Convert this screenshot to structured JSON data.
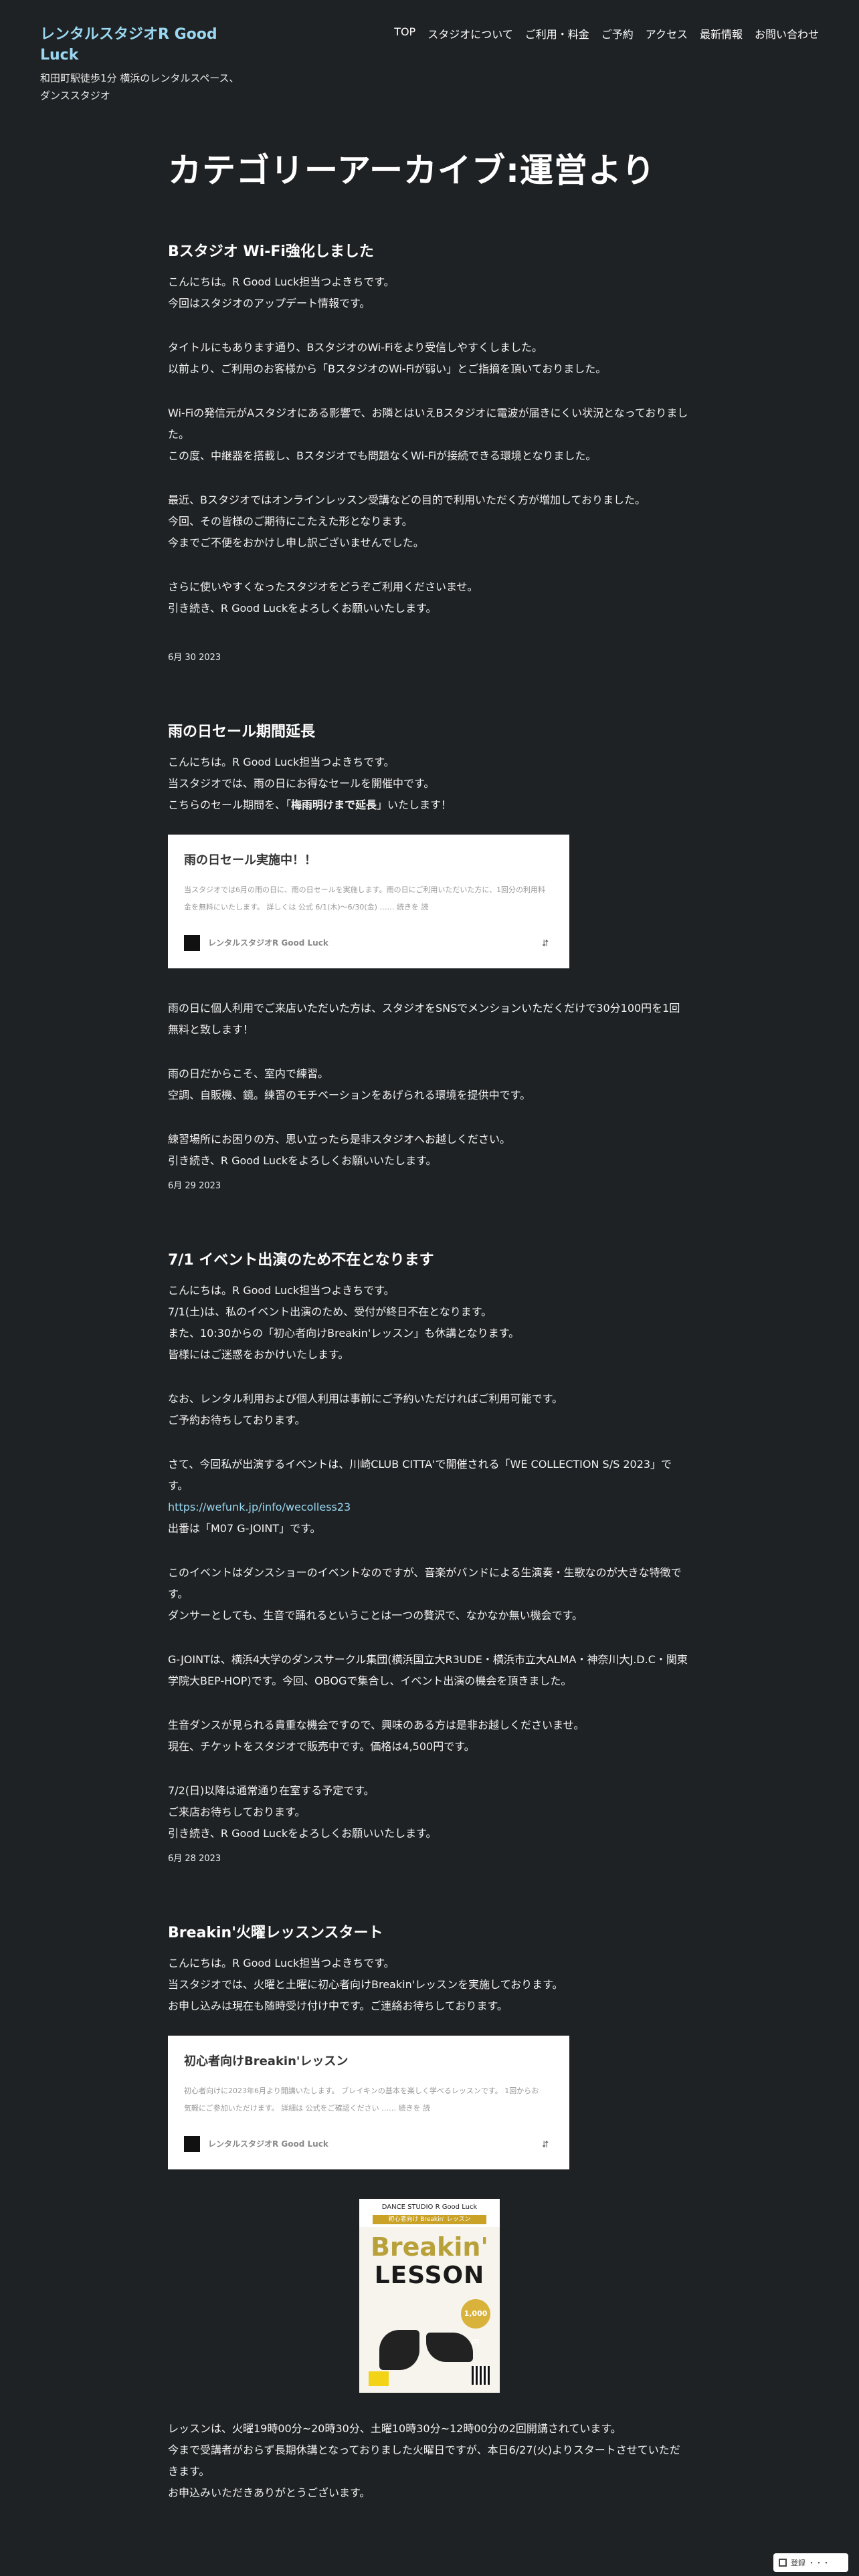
{
  "header": {
    "site_title": "レンタルスタジオR Good Luck",
    "site_description": "和田町駅徒歩1分 横浜のレンタルスペース、ダンススタジオ",
    "nav": [
      "TOP",
      "スタジオについて",
      "ご利用・料金",
      "ご予約",
      "アクセス",
      "最新情報",
      "お問い合わせ"
    ]
  },
  "archive_title": "カテゴリーアーカイブ:運営より",
  "posts": [
    {
      "title": "Bスタジオ Wi-Fi強化しました",
      "paragraphs": [
        [
          "こんにちは。R Good Luck担当つよきちです。",
          "今回はスタジオのアップデート情報です。"
        ],
        [
          "タイトルにもあります通り、BスタジオのWi-Fiをより受信しやすくしました。",
          "以前より、ご利用のお客様から「BスタジオのWi-Fiが弱い」とご指摘を頂いておりました。"
        ],
        [
          "Wi-Fiの発信元がAスタジオにある影響で、お隣とはいえBスタジオに電波が届きにくい状況となっておりました。",
          "この度、中継器を搭載し、Bスタジオでも問題なくWi-Fiが接続できる環境となりました。"
        ],
        [
          "最近、Bスタジオではオンラインレッスン受講などの目的で利用いただく方が増加しておりました。",
          "今回、その皆様のご期待にこたえた形となります。",
          "今までご不便をおかけし申し訳ございませんでした。"
        ],
        [
          "さらに使いやすくなったスタジオをどうぞご利用くださいませ。",
          "引き続き、R Good Luckをよろしくお願いいたします。"
        ]
      ],
      "date": "6月 30 2023"
    },
    {
      "title": "雨の日セール期間延長",
      "paragraphs_before": [
        [
          "こんにちは。R Good Luck担当つよきちです。",
          "当スタジオでは、雨の日にお得なセールを開催中です。",
          "こちらのセール期間を、「梅雨明けまで延長」いたします！"
        ]
      ],
      "bold_phrase": "梅雨明けまで延長",
      "embed": {
        "title": "雨の日セール実施中！！",
        "excerpt": "当スタジオでは6月の雨の日に、雨の日セールを実施します。雨の日にご利用いただいた方に、1回分の利用料金を無料にいたします。 詳しくは 公式 6/1(木)～6/30(金) …… 続きを 読",
        "site": "レンタルスタジオR Good Luck"
      },
      "paragraphs_after": [
        [
          "雨の日に個人利用でご来店いただいた方は、スタジオをSNSでメンションいただくだけで30分100円を1回無料と致します！"
        ],
        [
          "雨の日だからこそ、室内で練習。",
          "空調、自販機、鏡。練習のモチベーションをあげられる環境を提供中です。"
        ],
        [
          "練習場所にお困りの方、思い立ったら是非スタジオへお越しください。",
          "引き続き、R Good Luckをよろしくお願いいたします。"
        ]
      ],
      "date": "6月 29 2023"
    },
    {
      "title": "7/1 イベント出演のため不在となります",
      "paragraphs": [
        [
          "こんにちは。R Good Luck担当つよきちです。",
          "7/1(土)は、私のイベント出演のため、受付が終日不在となります。",
          "また、10:30からの「初心者向けBreakin'レッスン」も休講となります。",
          "皆様にはご迷惑をおかけいたします。"
        ],
        [
          "なお、レンタル利用および個人利用は事前にご予約いただければご利用可能です。",
          "ご予約お待ちしております。"
        ],
        [
          "さて、今回私が出演するイベントは、川崎CLUB CITTA'で開催される「WE COLLECTION S/S 2023」です。",
          "https://wefunk.jp/info/wecolless23",
          "出番は「M07 G-JOINT」です。"
        ],
        [
          "このイベントはダンスショーのイベントなのですが、音楽がバンドによる生演奏・生歌なのが大きな特徴です。",
          "ダンサーとしても、生音で踊れるということは一つの贅沢で、なかなか無い機会です。"
        ],
        [
          "G-JOINTは、横浜4大学のダンスサークル集団(横浜国立大R3UDE・横浜市立大ALMA・神奈川大J.D.C・関東学院大BEP-HOP)です。今回、OBOGで集合し、イベント出演の機会を頂きました。"
        ],
        [
          "生音ダンスが見られる貴重な機会ですので、興味のある方は是非お越しくださいませ。",
          "現在、チケットをスタジオで販売中です。価格は4,500円です。"
        ],
        [
          "7/2(日)以降は通常通り在室する予定です。",
          "ご来店お待ちしております。",
          "引き続き、R Good Luckをよろしくお願いいたします。"
        ]
      ],
      "link_text": "https://wefunk.jp/info/wecolless23",
      "date": "6月 28 2023"
    },
    {
      "title": "Breakin'火曜レッスンスタート",
      "paragraphs_before": [
        [
          "こんにちは。R Good Luck担当つよきちです。",
          "当スタジオでは、火曜と土曜に初心者向けBreakin'レッスンを実施しております。",
          "お申し込みは現在も随時受け付け中です。ご連絡お待ちしております。"
        ]
      ],
      "embed": {
        "title": "初心者向けBreakin'レッスン",
        "excerpt": "初心者向けに2023年6月より開講いたします。 ブレイキンの基本を楽しく学べるレッスンです。 1回からお気軽にご参加いただけます。 詳細は 公式をご確認ください …… 続きを 読",
        "site": "レンタルスタジオR Good Luck"
      },
      "poster": {
        "top_text": "DANCE STUDIO R Good Luck",
        "strip_text": "初心者向け Breakin' レッスン",
        "line1": "Breakin'",
        "line2": "LESSON",
        "price": "1,000円"
      },
      "paragraphs_after": [
        [
          "レッスンは、火曜19時00分~20時30分、土曜10時30分~12時00分の2回開講されています。",
          "今まで受講者がおらず長期休講となっておりました火曜日ですが、本日6/27(火)よりスタートさせていただきます。",
          "お申込みいただきありがとうございます。"
        ]
      ]
    }
  ],
  "footer_badge": "登録 ・・・"
}
